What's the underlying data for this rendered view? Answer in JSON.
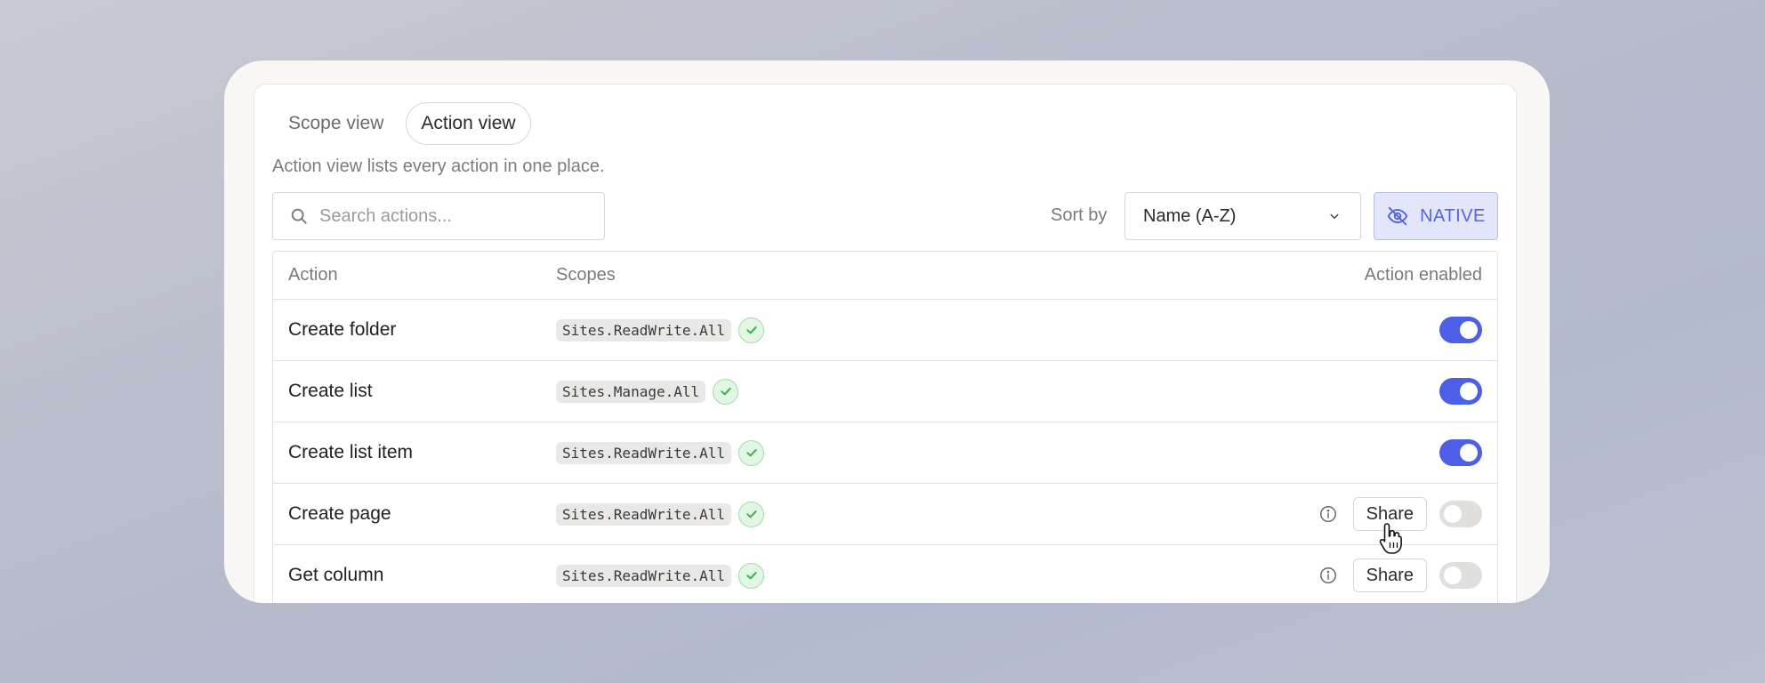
{
  "tabs": [
    {
      "label": "Scope view",
      "active": false
    },
    {
      "label": "Action view",
      "active": true
    }
  ],
  "description": "Action view lists every action in one place.",
  "search": {
    "placeholder": "Search actions...",
    "value": ""
  },
  "sort": {
    "label": "Sort by",
    "selected": "Name (A-Z)"
  },
  "native_button": {
    "label": "NATIVE",
    "icon": "eye-off-icon"
  },
  "table": {
    "headers": {
      "action": "Action",
      "scopes": "Scopes",
      "enabled": "Action enabled"
    },
    "rows": [
      {
        "action": "Create folder",
        "scope": "Sites.ReadWrite.All",
        "enabled": true,
        "share": null
      },
      {
        "action": "Create list",
        "scope": "Sites.Manage.All",
        "enabled": true,
        "share": null
      },
      {
        "action": "Create list item",
        "scope": "Sites.ReadWrite.All",
        "enabled": true,
        "share": null
      },
      {
        "action": "Create page",
        "scope": "Sites.ReadWrite.All",
        "enabled": false,
        "share": "Share"
      },
      {
        "action": "Get column",
        "scope": "Sites.ReadWrite.All",
        "enabled": false,
        "share": "Share"
      }
    ]
  },
  "colors": {
    "accent": "#4d5fe6",
    "check_green": "#3fae4f",
    "native_bg": "#e3e6fb"
  }
}
